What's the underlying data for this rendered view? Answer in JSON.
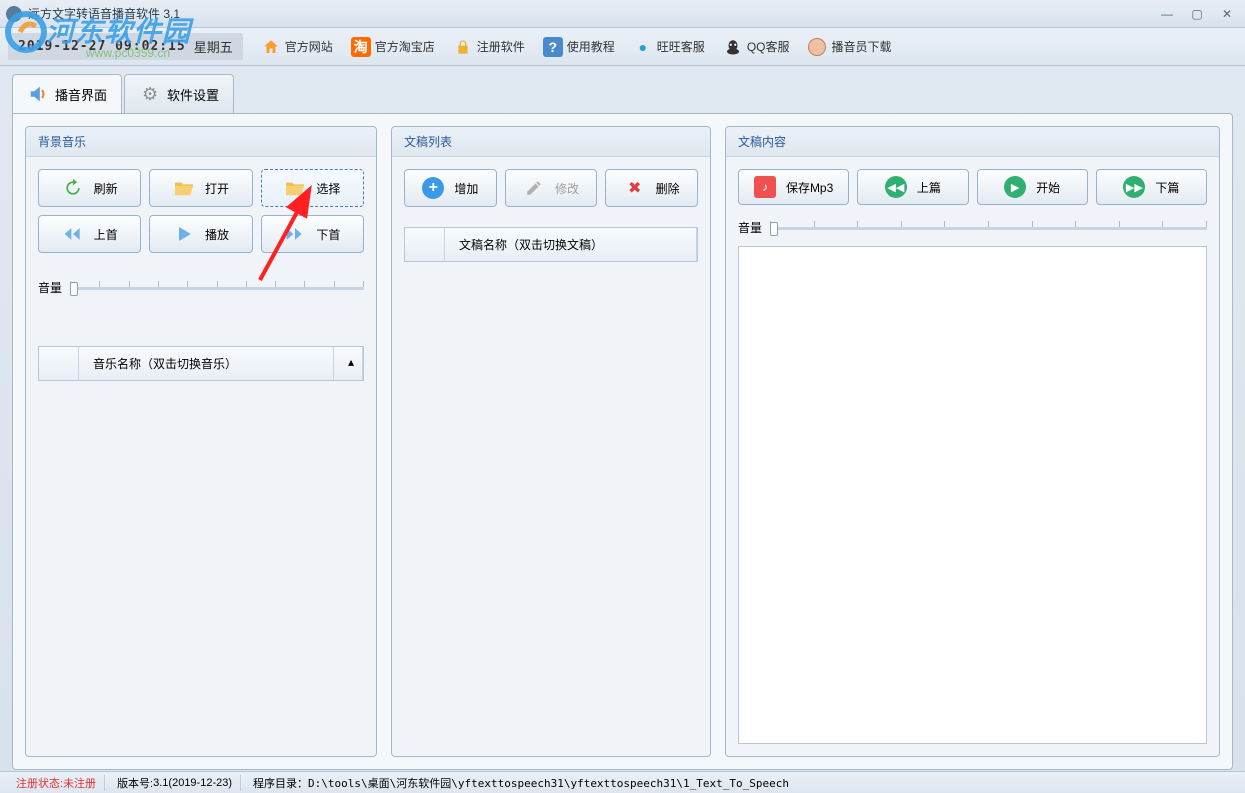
{
  "window": {
    "title": "远方文字转语音播音软件 3.1"
  },
  "datetime": {
    "value": "2019-12-27 09:02:15",
    "weekday": "星期五"
  },
  "toolbar_links": {
    "official_site": "官方网站",
    "taobao": "官方淘宝店",
    "register": "注册软件",
    "tutorial": "使用教程",
    "wangwang": "旺旺客服",
    "qq": "QQ客服",
    "announcer": "播音员下载"
  },
  "tabs": {
    "broadcast": "播音界面",
    "settings": "软件设置"
  },
  "bg_music": {
    "title": "背景音乐",
    "refresh": "刷新",
    "open": "打开",
    "select": "选择",
    "prev": "上首",
    "play": "播放",
    "next": "下首",
    "volume_label": "音量",
    "list_col": "音乐名称（双击切换音乐）"
  },
  "doc_list": {
    "title": "文稿列表",
    "add": "增加",
    "edit": "修改",
    "delete": "删除",
    "list_col": "文稿名称（双击切换文稿）"
  },
  "doc_content": {
    "title": "文稿内容",
    "save_mp3": "保存Mp3",
    "prev": "上篇",
    "start": "开始",
    "next": "下篇",
    "volume_label": "音量"
  },
  "status": {
    "reg_label": "注册状态:",
    "reg_value": "未注册",
    "version_label": "版本号:",
    "version_value": "3.1(2019-12-23)",
    "path_label": "程序目录：",
    "path_value": "D:\\tools\\桌面\\河东软件园\\yftexttospeech31\\yftexttospeech31\\1_Text_To_Speech"
  },
  "watermark": {
    "text": "河东软件园",
    "url": "www.pc0359.cn"
  }
}
